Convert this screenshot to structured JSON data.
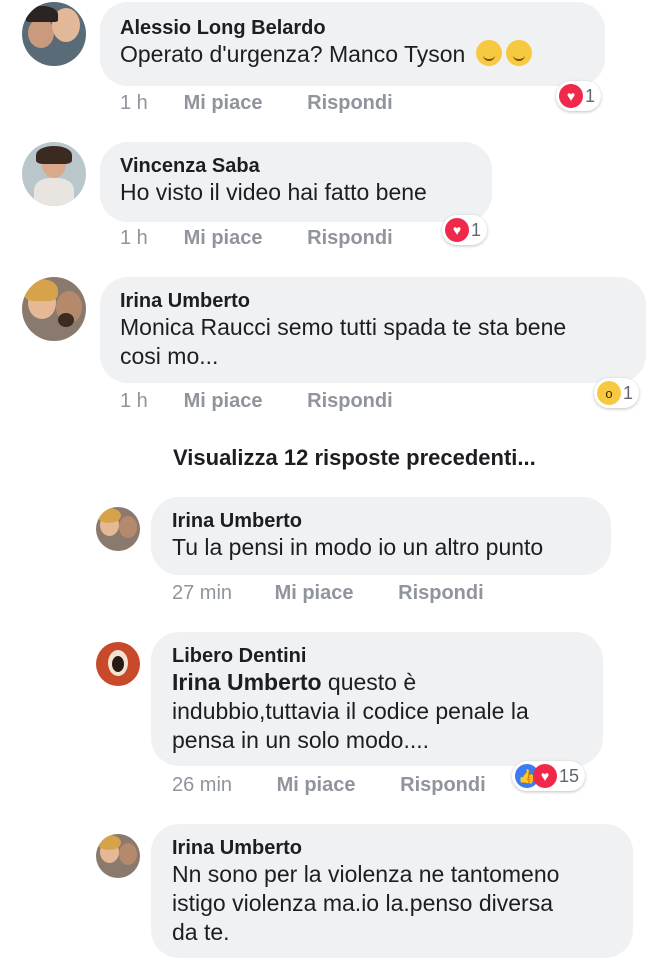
{
  "comments": [
    {
      "author": "Alessio Long Belardo",
      "text": "Operato d'urgenza? Manco Tyson",
      "emoji": "relieved-face-emoji",
      "time": "1 h",
      "like_label": "Mi piace",
      "reply_label": "Rispondi",
      "reaction_icon": "heart-icon",
      "reaction_count": "1"
    },
    {
      "author": "Vincenza Saba",
      "text": "Ho visto il video hai fatto bene",
      "time": "1 h",
      "like_label": "Mi piace",
      "reply_label": "Rispondi",
      "reaction_icon": "heart-icon",
      "reaction_count": "1"
    },
    {
      "author": "Irina Umberto",
      "text": "Monica Raucci semo tutti spada te sta bene\ncosi mo...",
      "time": "1 h",
      "like_label": "Mi piace",
      "reply_label": "Rispondi",
      "reaction_icon": "wow-icon",
      "reaction_count": "1"
    }
  ],
  "view_more": "Visualizza 12 risposte precedenti...",
  "replies": [
    {
      "author": "Irina Umberto",
      "text": "Tu la pensi in modo io un altro punto",
      "time": "27 min",
      "like_label": "Mi piace",
      "reply_label": "Rispondi"
    },
    {
      "author": "Libero Dentini",
      "mention": "Irina Umberto",
      "text": " questo è\nindubbio,tuttavia il codice penale la\npensa in un solo modo....",
      "time": "26 min",
      "like_label": "Mi piace",
      "reply_label": "Rispondi",
      "reaction_icons": [
        "like-icon",
        "heart-icon"
      ],
      "reaction_count": "15"
    },
    {
      "author": "Irina Umberto",
      "text": "Nn sono per la violenza ne tantomeno\nistigo violenza ma.io la.penso diversa\nda te."
    }
  ],
  "colors": {
    "bubble": "#eff1f3",
    "meta_text": "#90949c",
    "heart": "#f0284a",
    "like": "#3b7cf2",
    "wow": "#f7c940"
  }
}
